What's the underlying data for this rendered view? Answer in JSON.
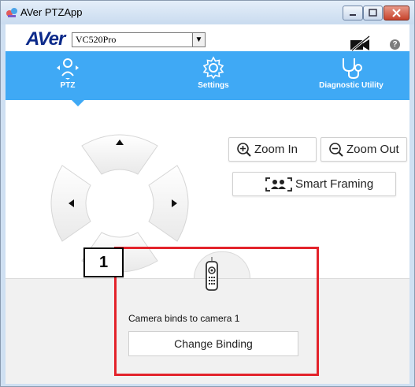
{
  "window": {
    "title": "AVer PTZApp"
  },
  "topbar": {
    "brand": "AVer",
    "camera_select": "VC520Pro"
  },
  "tabs": [
    {
      "label": "PTZ",
      "icon": "ptz-icon"
    },
    {
      "label": "Settings",
      "icon": "gear-icon"
    },
    {
      "label": "Diagnostic Utility",
      "icon": "stethoscope-icon"
    }
  ],
  "zoom": {
    "zoom_in": "Zoom In",
    "zoom_out": "Zoom Out",
    "smart_framing": "Smart Framing"
  },
  "binding": {
    "status": "Camera binds to camera 1",
    "button": "Change Binding"
  },
  "annotation": {
    "number": "1"
  },
  "colors": {
    "accent": "#3fa9f5",
    "callout": "#e3232b",
    "brand": "#0c2a8a"
  }
}
